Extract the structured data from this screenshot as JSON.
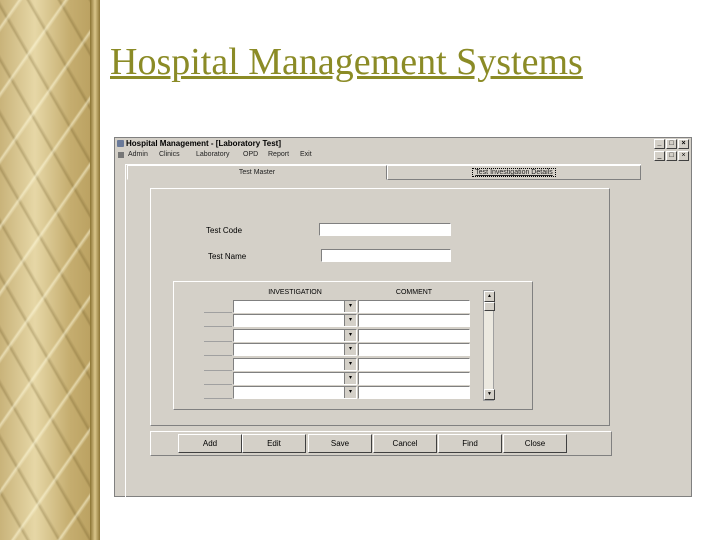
{
  "slide": {
    "title": "Hospital Management Systems"
  },
  "window": {
    "title": "Hospital Management - [Laboratory Test]",
    "controls": [
      "_",
      "□",
      "×"
    ],
    "menu": [
      "Admin",
      "Clinics",
      "Laboratory",
      "OPD",
      "Report",
      "Exit"
    ]
  },
  "tabs": [
    "Test Master",
    "Test Investigation Details"
  ],
  "form": {
    "test_code_label": "Test Code",
    "test_code_value": "",
    "test_name_label": "Test Name",
    "test_name_value": ""
  },
  "grid": {
    "columns": [
      "INVESTIGATION",
      "COMMENT"
    ],
    "rows": [
      {
        "investigation": "",
        "comment": ""
      },
      {
        "investigation": "",
        "comment": ""
      },
      {
        "investigation": "",
        "comment": ""
      },
      {
        "investigation": "",
        "comment": ""
      },
      {
        "investigation": "",
        "comment": ""
      },
      {
        "investigation": "",
        "comment": ""
      },
      {
        "investigation": "",
        "comment": ""
      }
    ]
  },
  "buttons": [
    "Add",
    "Edit",
    "Save",
    "Cancel",
    "Find",
    "Close"
  ],
  "icons": {
    "dropdown": "▾",
    "scroll_up": "▲",
    "scroll_down": "▼"
  }
}
